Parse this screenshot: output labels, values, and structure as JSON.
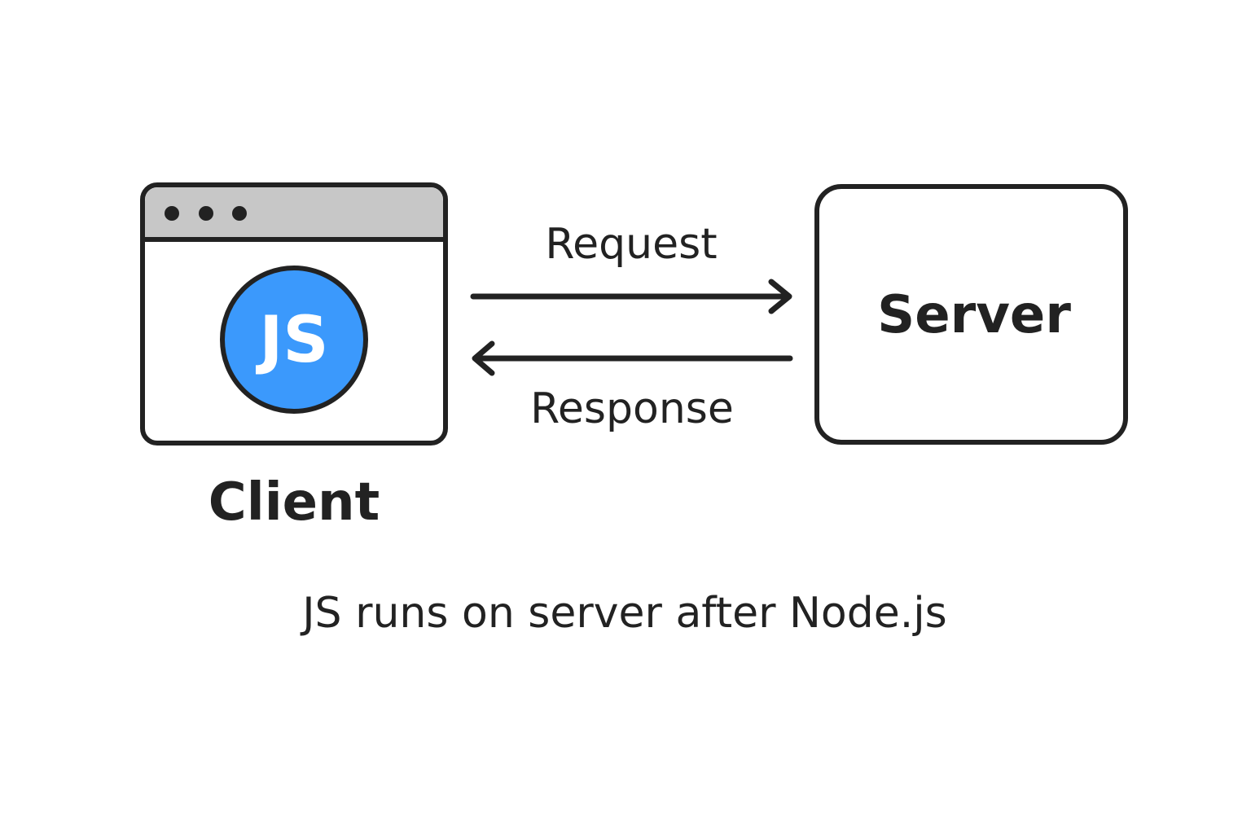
{
  "client": {
    "label": "Client",
    "badge_text": "JS",
    "window_dots": 3
  },
  "server": {
    "label": "Server"
  },
  "arrows": {
    "request_label": "Request",
    "response_label": "Response"
  },
  "caption": "JS runs on server after Node.js",
  "colors": {
    "stroke": "#222222",
    "titlebar": "#c7c7c7",
    "js_badge": "#3b99fc",
    "js_text": "#ffffff",
    "background": "#ffffff"
  },
  "icons": {
    "window_dot": "circle",
    "badge": "js-logo-circle"
  }
}
